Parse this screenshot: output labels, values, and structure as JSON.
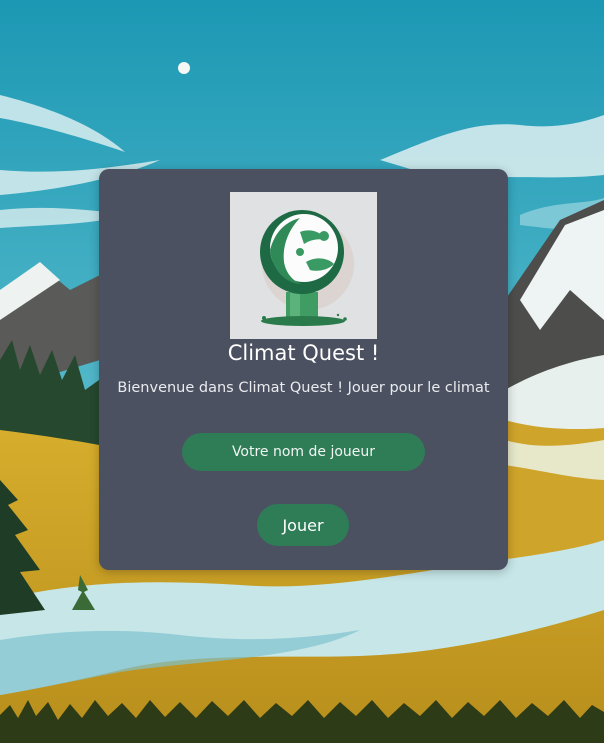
{
  "app": {
    "title": "Climat Quest !",
    "welcome": "Bienvenue dans Climat Quest ! Jouer pour le climat"
  },
  "form": {
    "name_placeholder": "Votre nom de joueur",
    "name_value": "",
    "play_label": "Jouer"
  },
  "icons": {
    "logo": "globe-on-stand-icon"
  },
  "colors": {
    "card": "#4b5160",
    "button": "#2e7d57",
    "sky": "#2aa0b8",
    "meadow": "#d4a82a",
    "river": "#bfe3e6"
  }
}
